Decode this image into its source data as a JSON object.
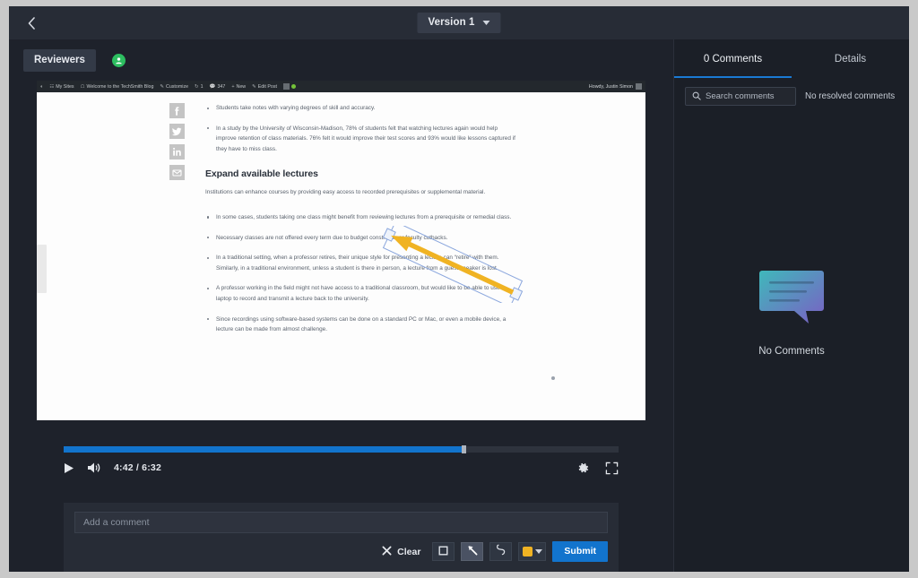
{
  "topbar": {
    "back_icon": "chevron-left-icon",
    "version_label": "Version 1",
    "version_caret_icon": "chevron-down-icon"
  },
  "toolbar": {
    "reviewers_label": "Reviewers",
    "avatar_icon": "user-avatar-icon"
  },
  "video": {
    "admin_bar": {
      "wp_logo_icon": "wordpress-icon",
      "items": [
        {
          "icon": "sites-icon",
          "label": "My Sites"
        },
        {
          "icon": "home-icon",
          "label": "Welcome to the TechSmith Blog"
        },
        {
          "icon": "brush-icon",
          "label": "Customize"
        },
        {
          "icon": "refresh-icon",
          "label": "1"
        },
        {
          "icon": "comment-icon",
          "label": "347"
        },
        {
          "icon": "plus-icon",
          "label": "New"
        },
        {
          "icon": "pencil-icon",
          "label": "Edit Post"
        }
      ],
      "user_greeting": "Howdy, Justin Simon"
    },
    "social_icons": [
      "facebook-icon",
      "twitter-icon",
      "linkedin-icon",
      "email-icon"
    ],
    "bullets_top": [
      "Students take notes with varying degrees of skill and accuracy.",
      "In a study by the University of Wisconsin-Madison, 78% of students felt that watching lectures again would help improve retention of class materials. 76% felt it would improve their test scores and 93% would like lessons captured if they have to miss class."
    ],
    "heading": "Expand available lectures",
    "paragraph": "Institutions can enhance courses by providing easy access to recorded prerequisites or supplemental material.",
    "bullets_bottom": [
      "In some cases, students taking one class might benefit from reviewing lectures from a prerequisite or remedial class.",
      "Necessary classes are not offered every term due to budget constraints or faculty cutbacks.",
      "In a traditional setting, when a professor retires, their unique style for presenting a lecture can “retire” with them. Similarly, in a traditional environment, unless a student is there in person, a lecture from a guest speaker is lost.",
      "A professor working in the field might not have access to a traditional classroom, but would like to be able to use a laptop to record and transmit a lecture back to the university.",
      "Since recordings using software-based systems can be done on a standard PC or Mac, or even a mobile device, a lecture can be made from almost challenge."
    ],
    "annotation": {
      "type": "arrow-annotation",
      "color": "#f0b323",
      "selected": true
    }
  },
  "player": {
    "play_icon": "play-icon",
    "volume_icon": "volume-icon",
    "time_display": "4:42 / 6:32",
    "current_time": "4:42",
    "duration": "6:32",
    "progress_percent": 72,
    "settings_icon": "gear-icon",
    "fullscreen_icon": "fullscreen-icon",
    "progress_color": "#1274cd"
  },
  "composer": {
    "comment_placeholder": "Add a comment",
    "comment_value": "",
    "clear_label": "Clear",
    "clear_icon": "close-x-icon",
    "tools": [
      {
        "name": "rectangle-tool",
        "icon": "square-icon",
        "active": false
      },
      {
        "name": "arrow-tool",
        "icon": "arrow-up-left-icon",
        "active": true
      },
      {
        "name": "freehand-tool",
        "icon": "squiggle-icon",
        "active": false
      }
    ],
    "color_swatch": "#f0b323",
    "color_caret_icon": "chevron-down-icon",
    "submit_label": "Submit",
    "submit_color": "#1274cd"
  },
  "right_panel": {
    "tabs": [
      {
        "label": "0 Comments",
        "active": true
      },
      {
        "label": "Details",
        "active": false
      }
    ],
    "search_placeholder": "Search comments",
    "search_value": "",
    "search_icon": "search-icon",
    "resolved_text": "No resolved comments",
    "empty_state_icon": "speech-bubble-icon",
    "empty_state_label": "No Comments",
    "accent_color": "#1a7ad4"
  }
}
